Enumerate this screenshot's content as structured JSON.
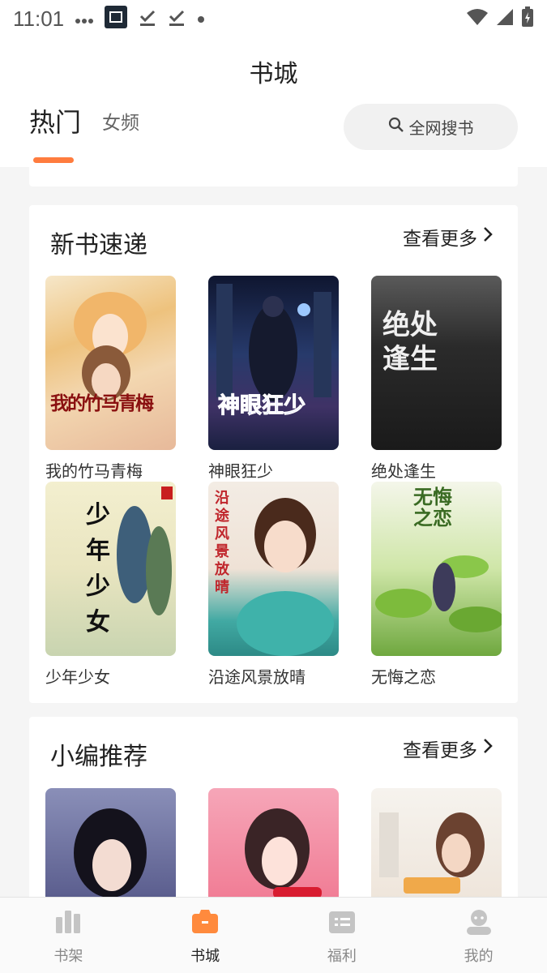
{
  "status_bar": {
    "time": "11:01",
    "icons": [
      "more-dots-icon",
      "app-icon",
      "download-done-icon",
      "download-done-icon",
      "dot-icon",
      "wifi-icon",
      "signal-icon",
      "battery-charging-icon"
    ]
  },
  "header": {
    "title": "书城",
    "tabs": [
      {
        "label": "热门",
        "active": true
      },
      {
        "label": "女频",
        "active": false
      }
    ],
    "search_label": "全网搜书"
  },
  "sections": [
    {
      "title": "新书速递",
      "more_label": "查看更多",
      "books": [
        {
          "name": "我的竹马青梅",
          "cover_text": "我的竹马青梅"
        },
        {
          "name": "神眼狂少",
          "cover_text": "神眼狂少"
        },
        {
          "name": "绝处逢生",
          "cover_text": "绝处逢生"
        },
        {
          "name": "少年少女",
          "cover_text": "少年少女"
        },
        {
          "name": "沿途风景放晴",
          "cover_text": "沿途风景放晴"
        },
        {
          "name": "无悔之恋",
          "cover_text": "无悔之恋"
        }
      ]
    },
    {
      "title": "小编推荐",
      "more_label": "查看更多",
      "books": [
        {
          "name": ""
        },
        {
          "name": ""
        },
        {
          "name": ""
        }
      ]
    }
  ],
  "tabbar": {
    "items": [
      {
        "label": "书架",
        "icon": "bookshelf-icon",
        "active": false
      },
      {
        "label": "书城",
        "icon": "bookstore-icon",
        "active": true
      },
      {
        "label": "福利",
        "icon": "welfare-icon",
        "active": false
      },
      {
        "label": "我的",
        "icon": "profile-icon",
        "active": false
      }
    ]
  },
  "colors": {
    "accent": "#ff7c3e",
    "background": "#f5f5f5"
  }
}
